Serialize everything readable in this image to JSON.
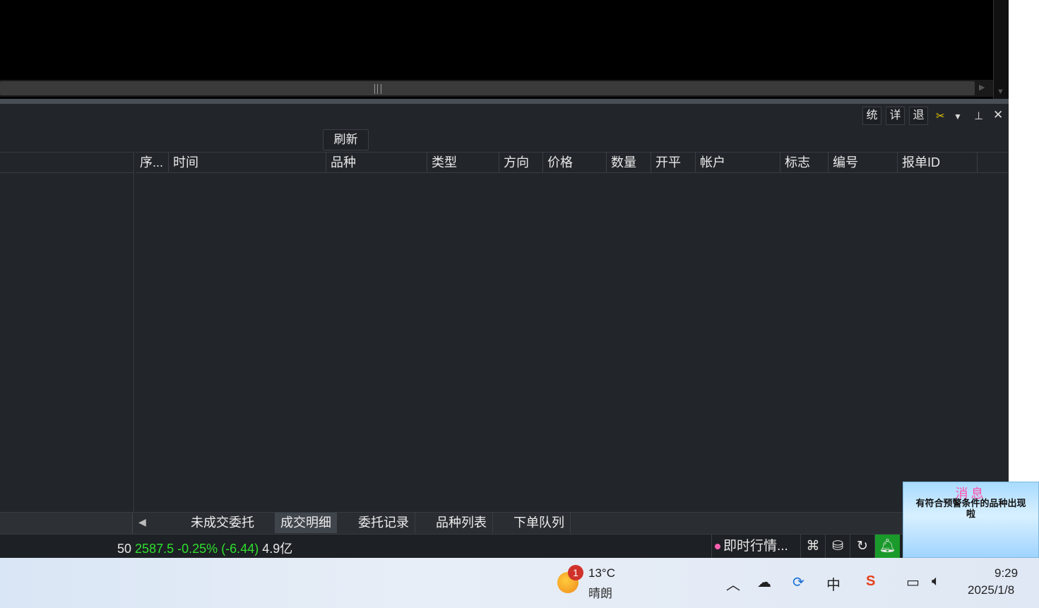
{
  "toolbar": {
    "stat_label": "统",
    "detail_label": "详",
    "exit_label": "退",
    "refresh_label": "刷新"
  },
  "grid": {
    "columns": [
      "序...",
      "时间",
      "品种",
      "类型",
      "方向",
      "价格",
      "数量",
      "开平",
      "帐户",
      "标志",
      "编号",
      "报单ID"
    ],
    "rows": []
  },
  "tabs": [
    "未成交委托",
    "成交明细",
    "委托记录",
    "品种列表",
    "下单队列"
  ],
  "active_tab": "成交明细",
  "status": {
    "index_code": "50",
    "index_price": "2587.5",
    "index_change_pct": "-0.25%",
    "index_change": "(-6.44)",
    "turnover": "4.9亿",
    "quote_mode": "即时行情..."
  },
  "notification": {
    "title": "消息",
    "message": "有符合预警条件的品种出现啦"
  },
  "taskbar": {
    "weather_badge": "1",
    "temperature": "13°C",
    "condition": "晴朗",
    "ime": "中",
    "time": "9:29",
    "date": "2025/1/8"
  },
  "colors": {
    "positive_green": "#2ee02e",
    "panel_bg": "#22262b",
    "bell_green": "#1a9a2a"
  }
}
